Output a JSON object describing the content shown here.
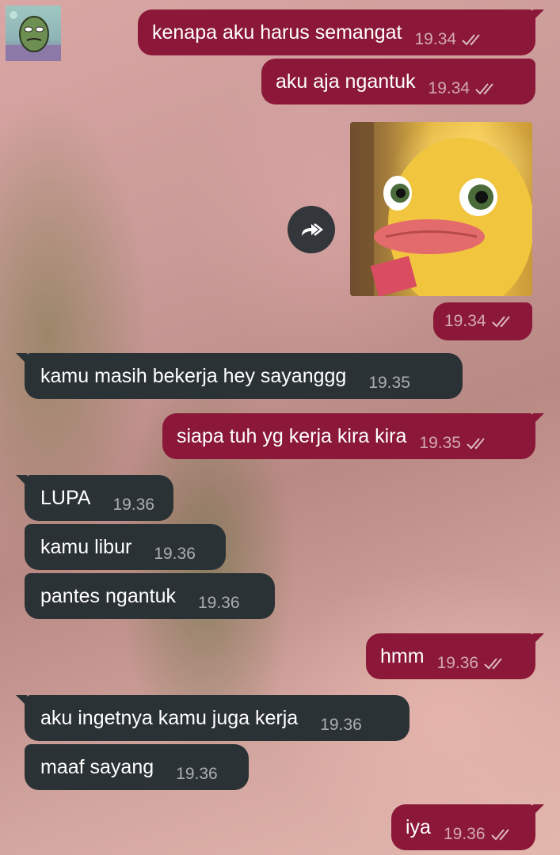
{
  "chat": {
    "messages": [
      {
        "side": "out",
        "text": "kenapa aku harus semangat",
        "time": "19.34"
      },
      {
        "side": "out",
        "text": "aku aja ngantuk",
        "time": "19.34"
      },
      {
        "side": "out",
        "type": "image",
        "time": "19.34"
      },
      {
        "side": "in",
        "text": "kamu masih bekerja hey sayanggg",
        "time": "19.35"
      },
      {
        "side": "out",
        "text": "siapa tuh yg kerja kira kira",
        "time": "19.35"
      },
      {
        "side": "in",
        "text": "LUPA",
        "time": "19.36"
      },
      {
        "side": "in",
        "text": "kamu libur",
        "time": "19.36"
      },
      {
        "side": "in",
        "text": "pantes ngantuk",
        "time": "19.36"
      },
      {
        "side": "out",
        "text": "hmm",
        "time": "19.36"
      },
      {
        "side": "in",
        "text": "aku ingetnya kamu juga kerja",
        "time": "19.36"
      },
      {
        "side": "in",
        "text": "maaf sayang",
        "time": "19.36"
      },
      {
        "side": "out",
        "text": "iya",
        "time": "19.36"
      }
    ]
  },
  "icons": {
    "read_receipt": "double-check-icon",
    "forward": "forward-icon",
    "avatar": "profile-avatar-icon"
  },
  "colors": {
    "outgoing_bubble": "#8b1838",
    "incoming_bubble": "#2b3236",
    "forward_button": "#33363a"
  }
}
